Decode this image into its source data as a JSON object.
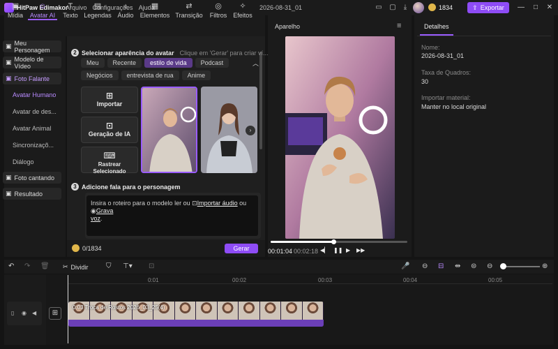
{
  "app": {
    "name": "HitPaw Edimakor",
    "menu": [
      "Arquivo",
      "Configurações",
      "Ajuda"
    ],
    "project_title": "2026-08-31_01",
    "credits": "1834",
    "export_label": "Exportar"
  },
  "toolbar": {
    "items": [
      {
        "label": "Mídia",
        "icon": "media-icon"
      },
      {
        "label": "Avatar AI",
        "icon": "avatar-ai-icon"
      },
      {
        "label": "Texto",
        "icon": "text-icon"
      },
      {
        "label": "Legendas",
        "icon": "captions-icon"
      },
      {
        "label": "Áudio",
        "icon": "audio-icon"
      },
      {
        "label": "Elementos",
        "icon": "elements-icon"
      },
      {
        "label": "Transição",
        "icon": "transition-icon"
      },
      {
        "label": "Filtros",
        "icon": "filters-icon"
      },
      {
        "label": "Efeitos",
        "icon": "effects-icon"
      }
    ],
    "active_index": 1
  },
  "sidebar": {
    "items": [
      "Meu Personagem",
      "Modelo de Vídeo",
      "Foto Falante"
    ],
    "sub_items": [
      "Avatar Humano",
      "Avatar de des...",
      "Avatar Animal",
      "Sincronizaçõ...",
      "Diálogo"
    ],
    "bottom_items": [
      "Foto cantando",
      "Resultado"
    ]
  },
  "content": {
    "step2": {
      "num": "2",
      "title": "Selecionar aparência do avatar",
      "hint": "Clique em 'Gerar' para criar ví..."
    },
    "chips_row1": [
      "Meu",
      "Recente",
      "estilo de vida",
      "Podcast"
    ],
    "chips_row2": [
      "Negócios",
      "entrevista de rua",
      "Anime"
    ],
    "active_chip": "estilo de vida",
    "actions": [
      {
        "label": "Importar",
        "icon": "plus-icon"
      },
      {
        "label": "Geração de IA",
        "icon": "ai-icon"
      },
      {
        "label": "Rastrear Selecionado",
        "icon": "track-icon"
      }
    ],
    "step3": {
      "num": "3",
      "title": "Adicione fala para o personagem"
    },
    "script": {
      "text_prefix": "Insira o roteiro para o modelo ler ou ",
      "import_audio": "Importar áudio",
      "or": " ou ",
      "record_a": "Grava",
      "record_b": "voz",
      "period": "."
    },
    "counter": "0/1834",
    "generate_label": "Gerar"
  },
  "preview": {
    "title": "Aparelho",
    "time_current": "00:01:04",
    "time_separator": "/",
    "time_total": "00:02:18",
    "progress": 0.46
  },
  "details": {
    "tab": "Detalhes",
    "fields": [
      {
        "label": "Nome:",
        "value": "2026-08-31_01"
      },
      {
        "label": "Taxa de Quadros:",
        "value": "30"
      },
      {
        "label": "Importar material:",
        "value": "Manter no local original"
      }
    ]
  },
  "timeline": {
    "split_label": "Dividir",
    "ruler": [
      "00:00",
      "0:01",
      "00:02",
      "00:03",
      "00:04",
      "00:05"
    ],
    "clip_label": "0:03  Troca de Rostos 2026_03_25(4)",
    "zoom": 0.05
  },
  "colors": {
    "accent": "#8e4cf5",
    "accent_text": "#b98bff",
    "background": "#141414",
    "panel": "#1b1b1b"
  }
}
